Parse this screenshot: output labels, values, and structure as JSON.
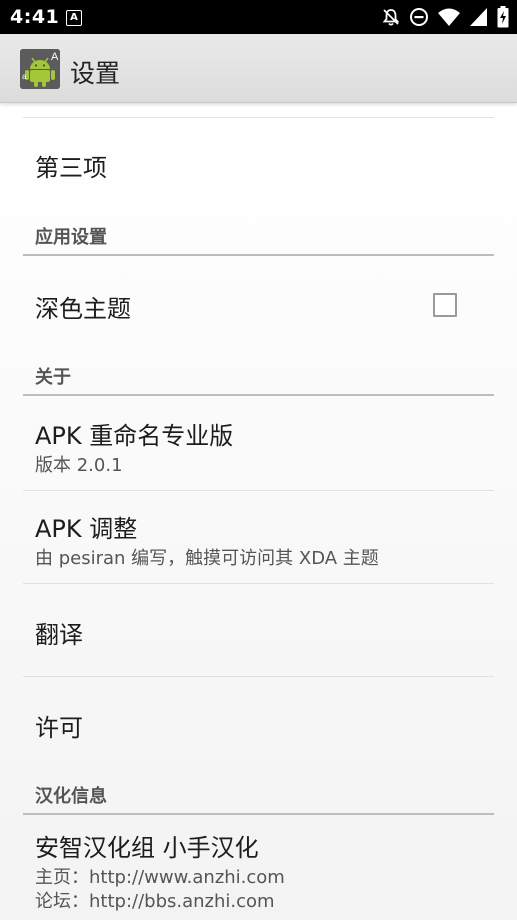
{
  "status_bar": {
    "time": "4:41",
    "notification_icon": "A",
    "icons": [
      "notifications-off-icon",
      "do-not-disturb-icon",
      "wifi-icon",
      "signal-icon",
      "battery-charging-icon"
    ]
  },
  "action_bar": {
    "app_icon": "android-app-icon",
    "title": "设置"
  },
  "preferences": {
    "item_third": {
      "title": "第三项"
    },
    "category_app": {
      "title": "应用设置"
    },
    "dark_theme": {
      "title": "深色主题",
      "checked": false
    },
    "category_about": {
      "title": "关于"
    },
    "apk_rename_pro": {
      "title": "APK 重命名专业版",
      "summary": "版本 2.0.1"
    },
    "apk_tweak": {
      "title": "APK 调整",
      "summary": "由 pesiran 编写，触摸可访问其 XDA 主题"
    },
    "translation": {
      "title": "翻译"
    },
    "license": {
      "title": "许可"
    },
    "category_localization": {
      "title": "汉化信息"
    },
    "localization_credit": {
      "title": "安智汉化组 小手汉化",
      "homepage": "主页：http://www.anzhi.com",
      "forum": "论坛：http://bbs.anzhi.com"
    }
  },
  "colors": {
    "status_bar": "#000000",
    "action_bar": "#e2e2e2",
    "category_text": "#555555",
    "category_divider": "#bdbdbd"
  }
}
